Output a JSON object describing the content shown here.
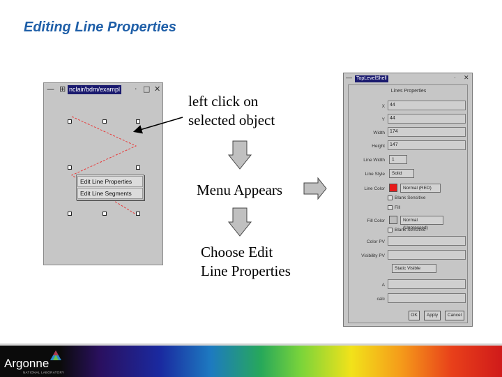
{
  "slide_title": "Editing Line Properties",
  "step1_lines": [
    "left click on",
    "selected object"
  ],
  "step2": "Menu Appears",
  "step3_lines": [
    "Choose Edit",
    "Line Properties"
  ],
  "left_window": {
    "title_path": "nclair/bdm/exampl",
    "controls": [
      "—",
      "□",
      "✕"
    ],
    "menu_items": [
      "Edit Line Properties",
      "Edit Line Segments"
    ]
  },
  "dialog": {
    "title": "TopLevelShell",
    "section": "Lines Properties",
    "fields": [
      {
        "label": "X",
        "value": "44"
      },
      {
        "label": "Y",
        "value": "44"
      },
      {
        "label": "Width",
        "value": "174"
      },
      {
        "label": "Height",
        "value": "147"
      }
    ],
    "line_width_label": "Line Width",
    "line_width_value": "1",
    "line_style_label": "Line Style",
    "line_style_value": "Solid",
    "line_color_label": "Line Color",
    "line_color_option": "Normal (RED)",
    "line_color_hex": "#e81a1a",
    "blank_sensitive_1": "Blank Sensitive",
    "fill_check": "Fill",
    "fill_color_label": "Fill Color",
    "fill_color_option": "Normal (Unpressed)",
    "blank_sensitive_2": "Blank Sensitive",
    "color_pv_label": "Color PV",
    "color_pv_value": "",
    "visibility_pv_label": "Visibility PV",
    "visibility_pv_value": "",
    "visibility_option": "Static Visible",
    "calc_label1": "A",
    "calc_value1": "",
    "calc_label2": "calc",
    "calc_value2": "",
    "buttons": [
      "OK",
      "Apply",
      "Cancel"
    ]
  },
  "footer": {
    "logo": "Argonne",
    "logo_sub": "NATIONAL LABORATORY"
  }
}
